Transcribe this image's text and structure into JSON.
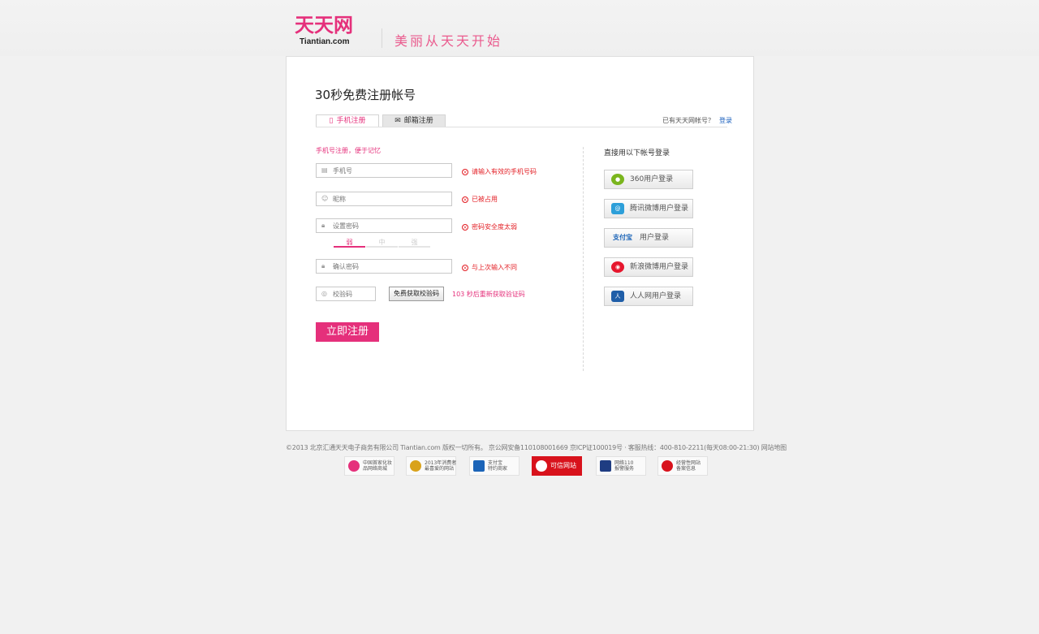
{
  "header": {
    "logo_cn": "天天网",
    "logo_en": "Tiantian.com",
    "slogan": "美丽从天天开始"
  },
  "form": {
    "title": "30秒免费注册帐号",
    "tabs": [
      {
        "label": "手机注册",
        "icon": "mobile-icon"
      },
      {
        "label": "邮箱注册",
        "icon": "mail-icon"
      }
    ],
    "have_account_text": "已有天天网帐号？",
    "login_link": "登录",
    "hint": "手机号注册，便于记忆",
    "fields": {
      "phone": {
        "placeholder": "手机号",
        "error": "请输入有效的手机号码"
      },
      "nickname": {
        "placeholder": "昵称",
        "error": "已被占用"
      },
      "password": {
        "placeholder": "设置密码",
        "error": "密码安全度太弱"
      },
      "confirm": {
        "placeholder": "确认密码",
        "error": "与上次输入不同"
      },
      "code": {
        "placeholder": "校验码"
      }
    },
    "strength": {
      "labels": [
        "弱",
        "中",
        "强"
      ],
      "level": 1
    },
    "get_code_button": "免费获取校验码",
    "countdown_text": "103 秒后重新获取验证码",
    "submit_label": "立即注册"
  },
  "third_party": {
    "title": "直接用以下帐号登录",
    "buttons": [
      {
        "label": "360用户登录",
        "icon": "360-icon",
        "color": "#7ab51d"
      },
      {
        "label": "腾讯微博用户登录",
        "icon": "tencent-weibo-icon",
        "color": "#2d9fd9"
      },
      {
        "label": "用户登录",
        "icon": "alipay-icon",
        "color": "#1b64b8",
        "icon_text": "支付宝"
      },
      {
        "label": "新浪微博用户登录",
        "icon": "sina-weibo-icon",
        "color": "#e6162d"
      },
      {
        "label": "人人网用户登录",
        "icon": "renren-icon",
        "color": "#1f5ea8"
      }
    ]
  },
  "footer": {
    "text": "©2013 北京汇通天天电子商务有限公司 Tiantian.com 版权一切所有。 京公网安备110108001669 京ICP证100019号 · 客服热线：400-810-2211(每天08:00-21:30) 网站地图",
    "badges": [
      {
        "text": "中国首家化妆\n品网络商城"
      },
      {
        "text": "2013年消费者\n最喜爱的网站"
      },
      {
        "text": "支付宝\n特约商家"
      },
      {
        "text": "可信网站"
      },
      {
        "text": "网络110\n报警服务"
      },
      {
        "text": "经营性网站\n备案信息"
      }
    ]
  },
  "colors": {
    "brand": "#e5307b",
    "error": "#e31e24",
    "link": "#1a5fbd"
  }
}
